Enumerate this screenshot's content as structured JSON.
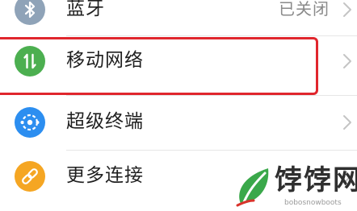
{
  "settings": {
    "items": [
      {
        "label": "蓝牙",
        "status": "已关闭",
        "icon": "bluetooth-icon",
        "icon_color": "#8fa3b8"
      },
      {
        "label": "移动网络",
        "icon": "mobile-data-icon",
        "icon_color": "#4caf50"
      },
      {
        "label": "超级终端",
        "icon": "super-device-icon",
        "icon_color": "#2c8ef0"
      },
      {
        "label": "更多连接",
        "icon": "link-icon",
        "icon_color": "#f5a623"
      }
    ]
  },
  "highlight_color": "#e0262d",
  "watermark": {
    "title": "饽饽网",
    "subtitle": "bobosnowboots"
  }
}
